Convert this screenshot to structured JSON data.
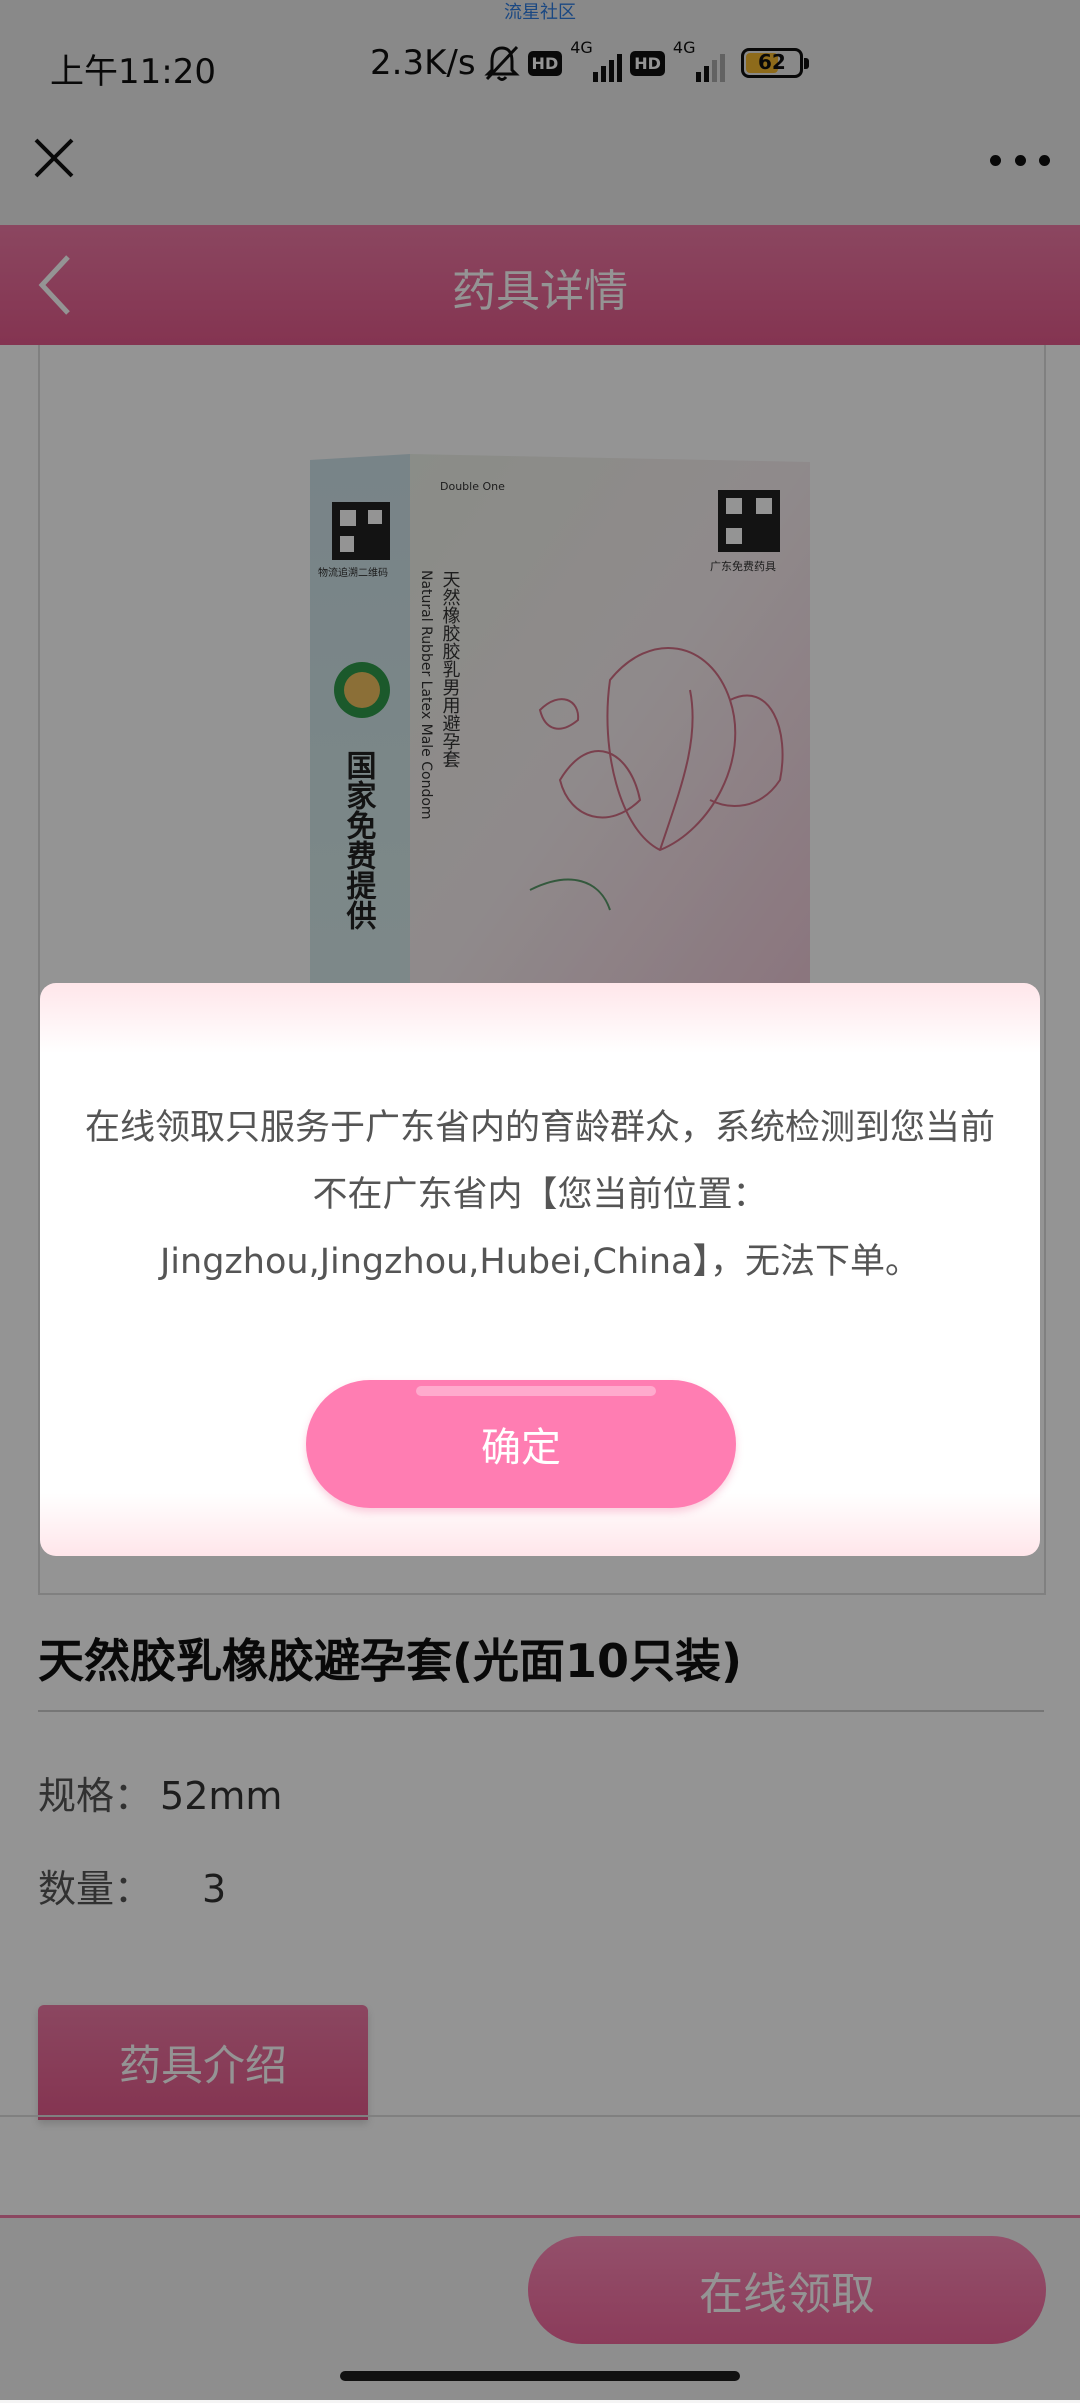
{
  "status_bar": {
    "watermark": "流星社区",
    "time": "上午11:20",
    "net_speed": "2.3K/s",
    "sim1_label": "4G",
    "sim2_label": "4G",
    "hd_label": "HD",
    "battery": "62",
    "battery_level": 0.62
  },
  "header": {
    "title": "药具详情"
  },
  "product": {
    "title": "天然胶乳橡胶避孕套(光面10只装)",
    "spec_label": "规格：",
    "spec_value": "52mm",
    "qty_label": "数量：",
    "qty_value": "3",
    "box_text": {
      "brand": "Double One",
      "cn_name": "天然橡胶胶乳男用避孕套",
      "en_name": "Natural Rubber Latex Male Condom",
      "side_text": "国家免费提供",
      "qr_caption_left": "物流追溯二维码",
      "qr_caption_right": "广东免费药具"
    }
  },
  "intro_tab": {
    "label": "药具介绍"
  },
  "bottom_bar": {
    "receive_label": "在线领取"
  },
  "dialog": {
    "message": "在线领取只服务于广东省内的育龄群众，系统检测到您当前不在广东省内【您当前位置：Jingzhou,Jingzhou,Hubei,China】，无法下单。",
    "confirm_label": "确定"
  },
  "colors": {
    "accent": "#e45a8c",
    "button_pink": "#ff7db2"
  }
}
